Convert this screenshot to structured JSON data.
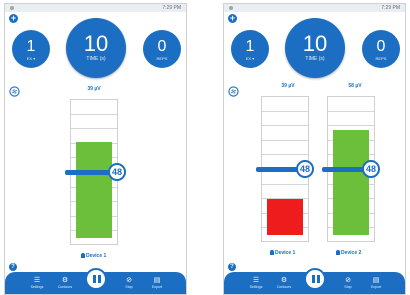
{
  "status": {
    "time": "7:29 PM"
  },
  "toolbar": {
    "settings_label": "Settings",
    "contours_label": "Contours",
    "stop_label": "Stop",
    "export_label": "Export"
  },
  "colors": {
    "primary": "#1b6ec2",
    "green": "#6cbf3b",
    "red": "#ee1c1c"
  },
  "left": {
    "ex_value": "1",
    "ex_label": "EX ▾",
    "time_value": "10",
    "time_label": "TIME (s)",
    "reps_value": "0",
    "reps_label": "REPS",
    "devices": [
      {
        "uv": "39 µV",
        "threshold": "48",
        "name": "Device 1",
        "level": 0.72,
        "color": "green"
      }
    ]
  },
  "right": {
    "ex_value": "1",
    "ex_label": "EX ▾",
    "time_value": "10",
    "time_label": "TIME (s)",
    "reps_value": "0",
    "reps_label": "REPS",
    "devices": [
      {
        "uv": "39 µV",
        "threshold": "48",
        "name": "Device 1",
        "level": 0.27,
        "color": "red"
      },
      {
        "uv": "58 µV",
        "threshold": "48",
        "name": "Device 2",
        "level": 0.78,
        "color": "green"
      }
    ]
  }
}
